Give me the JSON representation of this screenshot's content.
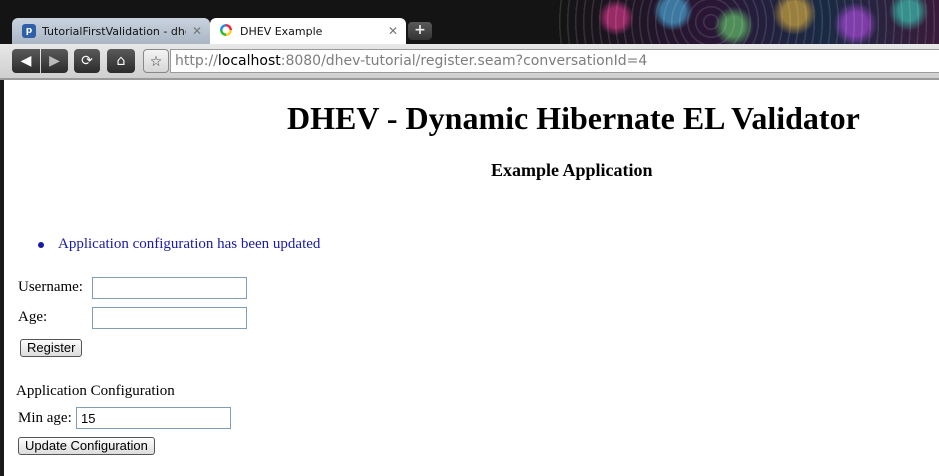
{
  "browser": {
    "tabs": [
      {
        "title": "TutorialFirstValidation - dhe…",
        "active": false
      },
      {
        "title": "DHEV Example",
        "active": true
      }
    ],
    "new_tab_glyph": "+",
    "address": {
      "scheme": "http://",
      "host": "localhost",
      "rest": ":8080/dhev-tutorial/register.seam?conversationId=4"
    },
    "icons": {
      "back": "back-arrow-icon",
      "forward": "forward-arrow-icon",
      "reload": "reload-icon",
      "home": "home-icon",
      "bookmark": "star-icon"
    }
  },
  "page": {
    "title": "DHEV - Dynamic Hibernate EL Validator",
    "subtitle": "Example Application",
    "messages": [
      "Application configuration has been updated"
    ],
    "register_form": {
      "username_label": "Username:",
      "username_value": "",
      "age_label": "Age:",
      "age_value": "",
      "register_button": "Register"
    },
    "config_form": {
      "heading": "Application Configuration",
      "min_age_label": "Min age:",
      "min_age_value": "15",
      "update_button": "Update Configuration"
    }
  },
  "colors": {
    "message": "#1a1aa8",
    "input_border": "#7f9db9"
  }
}
